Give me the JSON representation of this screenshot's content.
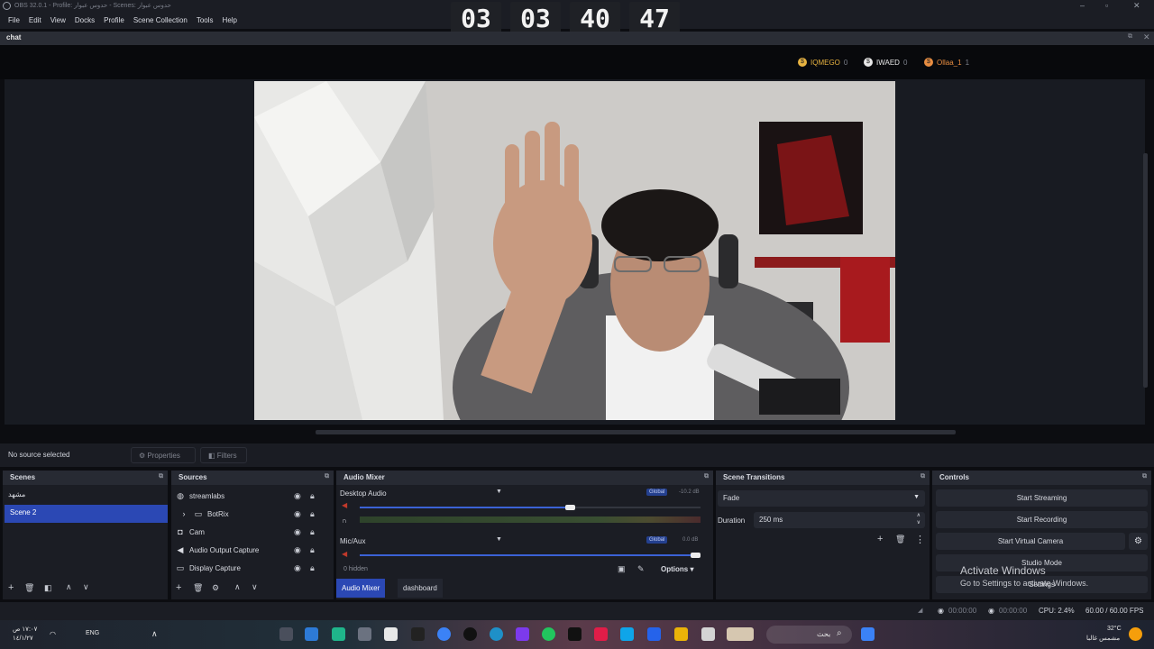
{
  "window": {
    "title": "OBS 32.0.1 - Profile: حدوس عبوار - Scenes: حدوس عبوار"
  },
  "menu": [
    "File",
    "Edit",
    "View",
    "Docks",
    "Profile",
    "Scene Collection",
    "Tools",
    "Help"
  ],
  "timer": {
    "groups": [
      "03",
      "03",
      "40",
      "47"
    ]
  },
  "chat": {
    "title": "chat",
    "viewers": [
      {
        "name": "IQMEGO",
        "count": "0",
        "color": "#e8b341"
      },
      {
        "name": "IWAED",
        "count": "0",
        "color": "#e8e8e8"
      },
      {
        "name": "Ollaa_1",
        "count": "1",
        "color": "#e88d41"
      }
    ]
  },
  "context_bar": {
    "no_source": "No source selected",
    "properties": "Properties",
    "filters": "Filters"
  },
  "scenes": {
    "title": "Scenes",
    "items": [
      "مشهد",
      "Scene 2"
    ],
    "selected": 1
  },
  "sources": {
    "title": "Sources",
    "items": [
      {
        "label": "streamlabs",
        "icon": "globe-icon"
      },
      {
        "label": "BotRix",
        "icon": "folder-icon"
      },
      {
        "label": "Cam",
        "icon": "camera-icon"
      },
      {
        "label": "Audio Output Capture",
        "icon": "speaker-icon"
      },
      {
        "label": "Display Capture",
        "icon": "monitor-icon"
      }
    ]
  },
  "audio_mixer": {
    "title": "Audio Mixer",
    "channels": [
      {
        "name": "Desktop Audio",
        "badge": "Global",
        "db": "-10.2 dB",
        "volume": 0.62
      },
      {
        "name": "Mic/Aux",
        "badge": "Global",
        "db": "0.0 dB",
        "volume": 1.0
      }
    ],
    "hidden": "0 hidden",
    "options": "Options",
    "tabs": [
      "Audio Mixer",
      "dashboard"
    ]
  },
  "scene_transitions": {
    "title": "Scene Transitions",
    "transition": "Fade",
    "duration_label": "Duration",
    "duration": "250 ms"
  },
  "controls": {
    "title": "Controls",
    "buttons": [
      "Start Streaming",
      "Start Recording",
      "Start Virtual Camera",
      "Studio Mode",
      "Settings"
    ]
  },
  "status": {
    "cpu": "CPU: 2.4%",
    "fps": "60.00 / 60.00 FPS",
    "rec_time": "00:00:00",
    "stream_time": "00:00:00"
  },
  "activate": {
    "line1": "Activate Windows",
    "line2": "Go to Settings to activate Windows."
  },
  "taskbar": {
    "search": "بحث",
    "lang": "ENG",
    "weather_temp": "32°C",
    "weather_desc": "مشمس غالبا",
    "time": "١٧:٠٧ ص",
    "date": "١٤/١/٢٧"
  }
}
